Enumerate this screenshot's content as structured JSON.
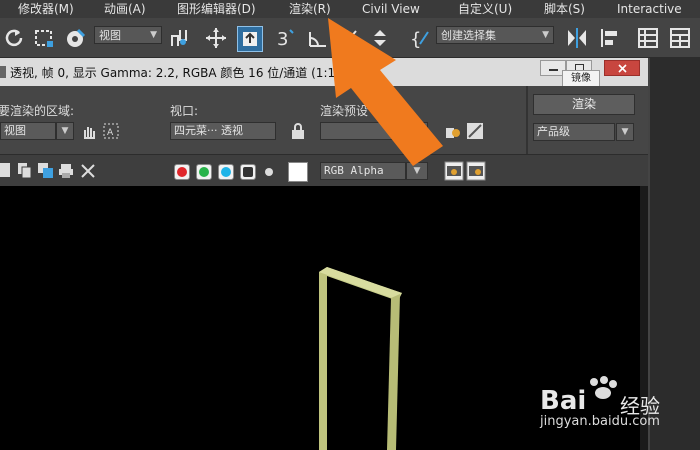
{
  "menu": [
    "修改器(M)",
    "动画(A)",
    "图形编辑器(D)",
    "渲染(R)",
    "Civil View",
    "自定义(U)",
    "脚本(S)",
    "Interactive"
  ],
  "toolbar": {
    "view_dropdown": "视图",
    "selection_set": "创建选择集",
    "icons": [
      "undo-icon",
      "select-region-icon",
      "paint-select-icon",
      "view-dropdown",
      "snap-icon",
      "move-icon",
      "select-link-icon",
      "snap-3-icon",
      "angle-snap-icon",
      "percent-snap-icon",
      "spinner-snap-icon",
      "edit-named-icon",
      "mirror-icon",
      "align-icon",
      "layer-icon",
      "ribbon-icon"
    ]
  },
  "render_window": {
    "title": "透视, 帧 0, 显示 Gamma: 2.2, RGBA 颜色 16 位/通道 (1:1)",
    "tooltip": "镜像",
    "area_label": "要渲染的区域:",
    "area_value": "视图",
    "viewport_label": "视口:",
    "viewport_value": "四元菜··· 透视",
    "preset_label": "渲染预设",
    "render_button": "渲染",
    "quality_value": "产品级",
    "channel_value": "RGB Alpha"
  },
  "colors": {
    "red_channel": "#e0262b",
    "green_channel": "#28b34a",
    "blue_channel": "#1fb4e8",
    "arrow": "#f07a1e",
    "frame": "#c9cf8c"
  },
  "watermark": {
    "brand": "Bai",
    "sub": "经验",
    "url": "jingyan.baidu.com"
  }
}
